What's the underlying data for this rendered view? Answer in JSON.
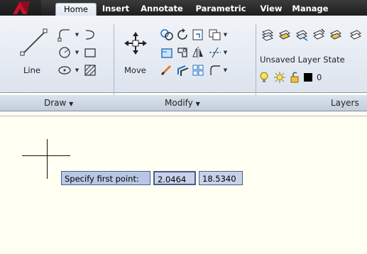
{
  "tabs": [
    "Home",
    "Insert",
    "Annotate",
    "Parametric",
    "View",
    "Manage"
  ],
  "panels": {
    "draw": {
      "title": "Draw",
      "line_label": "Line"
    },
    "modify": {
      "title": "Modify",
      "move_label": "Move"
    },
    "layers": {
      "title": "Layers",
      "layer_state": "Unsaved Layer State",
      "current_layer": "0"
    }
  },
  "prompt": {
    "label": "Specify first point:",
    "x_value": "2.0464",
    "y_value": "18.5340"
  },
  "colors": {
    "canvas_bg": "#fffff2",
    "tooltip_bg": "#b9c7e6",
    "tab_bar": "#2b2b2b",
    "ribbon": "#e6ebf2"
  },
  "icons": [
    "app-logo-icon",
    "line-icon",
    "polyline-icon",
    "polyline-dropdown",
    "arc-icon",
    "circle-icon",
    "circle-dropdown",
    "rectangle-icon",
    "ellipse-icon",
    "ellipse-dropdown",
    "hatch-icon",
    "move-icon",
    "copy-icon",
    "rotate-icon",
    "trim-icon",
    "array-icon",
    "stretch-icon",
    "mirror-icon",
    "fillet-icon",
    "erase-icon",
    "offset-icon",
    "scale-icon",
    "layer-properties-icon",
    "make-current-icon",
    "lightbulb-icon",
    "sun-icon",
    "lock-icon",
    "layer-color-swatch"
  ]
}
